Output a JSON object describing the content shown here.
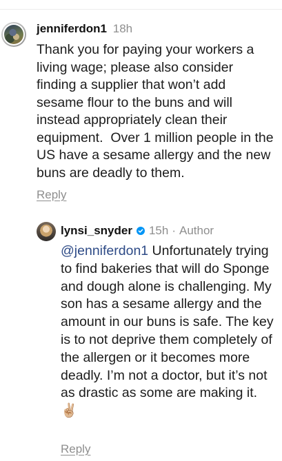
{
  "comments": [
    {
      "username": "jenniferdon1",
      "time": "18h",
      "text": "Thank you for paying your workers a living wage; please also consider finding a supplier that won’t add sesame flour to the buns and will instead appropriately clean their equipment.  Over 1 million people in the US have a sesame allergy and the new buns are deadly to them.",
      "reply_label": "Reply"
    }
  ],
  "replies": [
    {
      "username": "lynsi_snyder",
      "verified": true,
      "time": "15h",
      "author_label": "Author",
      "mention": "@jenniferdon1",
      "text": " Unfortunately trying to find bakeries that will do Sponge and dough alone is challenging. My son has a sesame allergy and the amount in our buns is safe. The key is to not deprive them completely of the allergen or it becomes more deadly. I’m not a doctor, but it’s not as drastic as some are making it. ",
      "emoji": "✌🏼",
      "reply_label": "Reply"
    }
  ],
  "colors": {
    "username": "#111111",
    "muted": "#8e8e8e",
    "mention": "#2d4a86",
    "verified_badge": "#0095f6"
  }
}
